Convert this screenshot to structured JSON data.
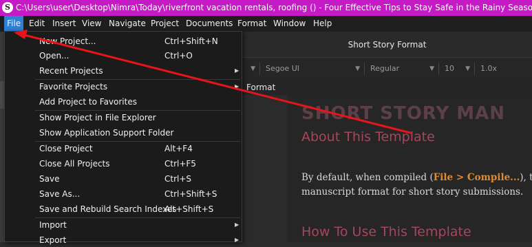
{
  "window": {
    "logo_glyph": "S",
    "title": "C:\\Users\\user\\Desktop\\Nimra\\Today\\riverfront vacation rentals, roofing () - Four Effective Tips to Stay Safe in the Rainy Season.docx.scriv - Scri"
  },
  "menubar": {
    "items": [
      "File",
      "Edit",
      "Insert",
      "View",
      "Navigate",
      "Project",
      "Documents",
      "Format",
      "Window",
      "Help"
    ]
  },
  "file_menu": {
    "items": [
      {
        "label": "New Project...",
        "shortcut": "Ctrl+Shift+N"
      },
      {
        "label": "Open...",
        "shortcut": "Ctrl+O"
      },
      {
        "label": "Recent Projects",
        "shortcut": ""
      },
      {
        "label": "Favorite Projects",
        "shortcut": ""
      },
      {
        "label": "Add Project to Favorites",
        "shortcut": ""
      },
      {
        "label": "Show Project in File Explorer",
        "shortcut": ""
      },
      {
        "label": "Show Application Support Folder",
        "shortcut": ""
      },
      {
        "label": "Close Project",
        "shortcut": "Alt+F4"
      },
      {
        "label": "Close All Projects",
        "shortcut": "Ctrl+F5"
      },
      {
        "label": "Save",
        "shortcut": "Ctrl+S"
      },
      {
        "label": "Save As...",
        "shortcut": "Ctrl+Shift+S"
      },
      {
        "label": "Save and Rebuild Search Indexes",
        "shortcut": "Alt+Shift+S"
      },
      {
        "label": "Import",
        "shortcut": ""
      },
      {
        "label": "Export",
        "shortcut": ""
      }
    ],
    "submenu_arrow": "▶"
  },
  "editor": {
    "header_title": "Short Story Format",
    "toolbar": {
      "paragraph_style": "",
      "font": "Segoe UI",
      "weight": "Regular",
      "size": "10",
      "line_spacing": "1.0x"
    },
    "format_label": "Format",
    "doc": {
      "heading": "SHORT STORY MAN",
      "subheading": "About This Template",
      "body_line1_a": "By default, when compiled (",
      "body_line1_link": "File > Compile...",
      "body_line1_b": "), this",
      "body_line2": "manuscript format for short story submissions.",
      "subheading2": "How To Use This Template"
    }
  },
  "colors": {
    "title_bar": "#c51ac5",
    "menu_active": "#2f7fd3",
    "annotation_arrow": "#e8141b",
    "heading": "#5c4048",
    "subheading": "#a8465d",
    "link": "#e38a2e"
  }
}
